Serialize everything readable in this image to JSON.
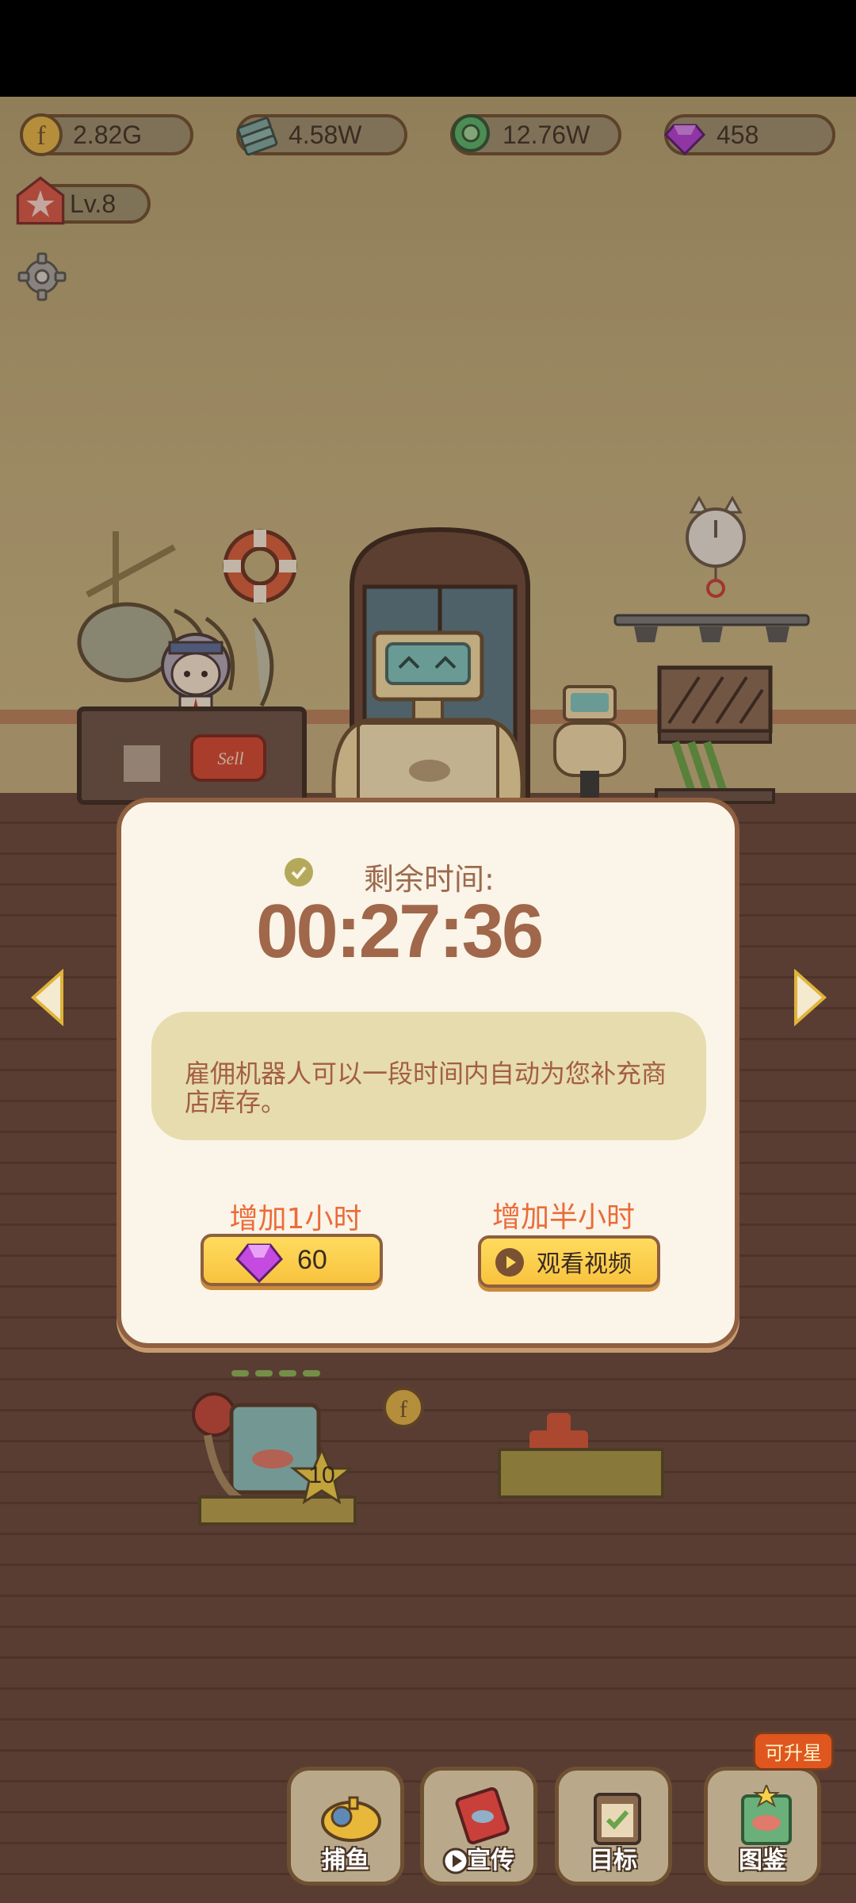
{
  "hud": {
    "coins": "2.82G",
    "cash": "4.58W",
    "tickets": "12.76W",
    "gems": "458",
    "level": "Lv.8"
  },
  "scenery": {
    "sell_sign": "Sell"
  },
  "dialog": {
    "remaining_label": "剩余时间:",
    "timer": "00:27:36",
    "description": "雇佣机器人可以一段时间内自动为您补充商店库存。",
    "option_1": {
      "title": "增加1小时",
      "button_value": "60"
    },
    "option_2": {
      "title": "增加半小时",
      "button_label": "观看视频"
    }
  },
  "tank": {
    "star_number": "10"
  },
  "bottom_nav": [
    {
      "label": "捕鱼"
    },
    {
      "label": "宣传"
    },
    {
      "label": "目标"
    },
    {
      "label": "图鉴",
      "badge": "可升星"
    }
  ],
  "colors": {
    "accent_orange": "#ea6c3a",
    "button_yellow": "#ffdb5e",
    "dialog_bg": "#fbf4e8",
    "gem_purple": "#b23fd6"
  }
}
